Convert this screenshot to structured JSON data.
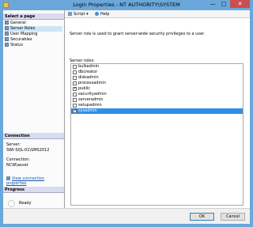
{
  "window": {
    "title": "Login Properties - NT AUTHORITY\\SYSTEM",
    "minimize": "—",
    "maximize": "□",
    "close": "✕"
  },
  "left_panel": {
    "select_page_header": "Select a page",
    "pages": [
      {
        "label": "General",
        "selected": false
      },
      {
        "label": "Server Roles",
        "selected": true
      },
      {
        "label": "User Mapping",
        "selected": false
      },
      {
        "label": "Securables",
        "selected": false
      },
      {
        "label": "Status",
        "selected": false
      }
    ],
    "connection_header": "Connection",
    "server_label": "Server:",
    "server_value": "SWI-SQL-01\\SMS2012",
    "connection_label": "Connection:",
    "connection_value": "NCW\\asvet",
    "view_connection_link": "View connection properties",
    "progress_header": "Progress",
    "progress_status": "Ready"
  },
  "toolbar": {
    "script_label": "Script",
    "help_label": "Help"
  },
  "main": {
    "description": "Server role is used to grant server-wide security privileges to a user.",
    "roles_label": "Server roles:",
    "roles": [
      {
        "name": "bulkadmin",
        "checked": false,
        "selected": false
      },
      {
        "name": "dbcreator",
        "checked": false,
        "selected": false
      },
      {
        "name": "diskadmin",
        "checked": false,
        "selected": false
      },
      {
        "name": "processadmin",
        "checked": false,
        "selected": false
      },
      {
        "name": "public",
        "checked": true,
        "selected": false
      },
      {
        "name": "securityadmin",
        "checked": false,
        "selected": false
      },
      {
        "name": "serveradmin",
        "checked": false,
        "selected": false
      },
      {
        "name": "setupadmin",
        "checked": false,
        "selected": false
      },
      {
        "name": "sysadmin",
        "checked": true,
        "selected": true
      }
    ]
  },
  "buttons": {
    "ok": "OK",
    "cancel": "Cancel"
  },
  "colors": {
    "window_frame": "#6aa7da",
    "selection": "#2f8ee6",
    "close_button": "#c75050",
    "link": "#1659b5"
  }
}
